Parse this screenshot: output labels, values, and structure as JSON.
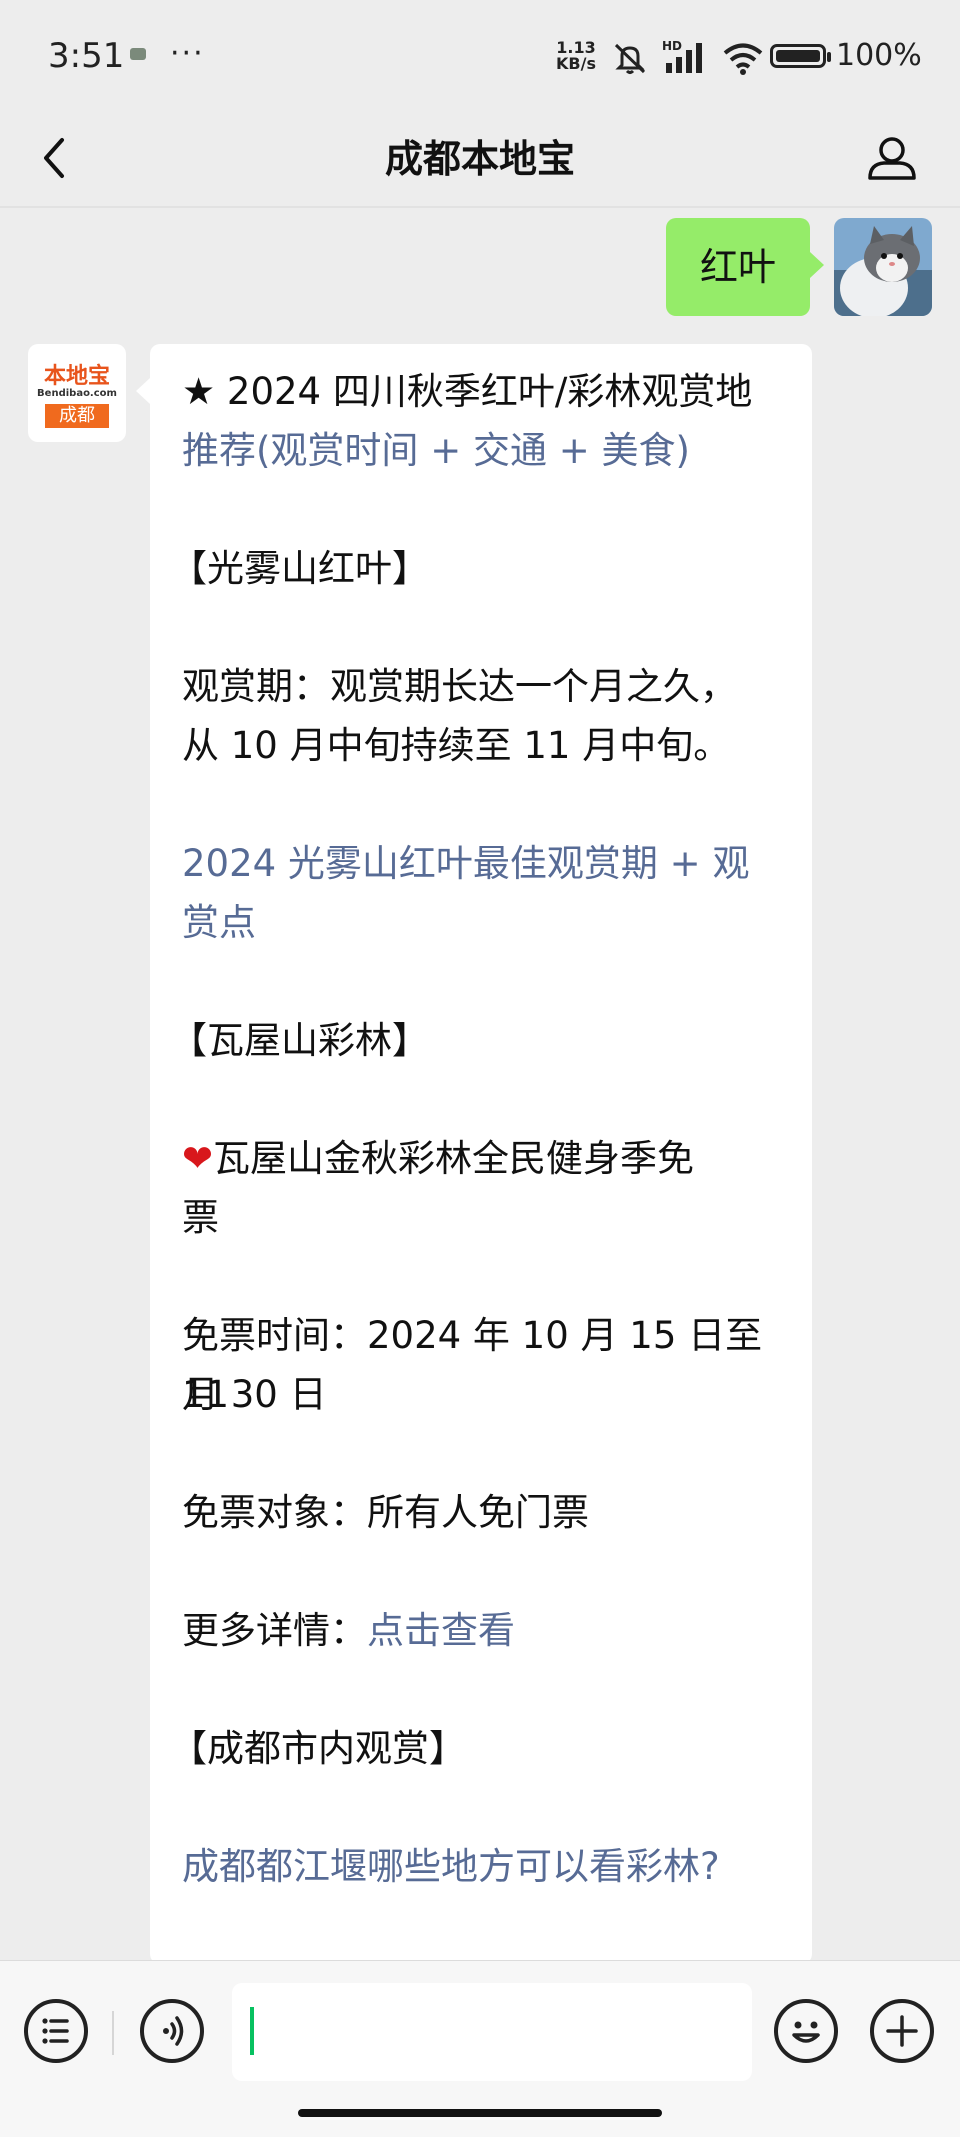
{
  "status_bar": {
    "time": "3:51",
    "dots": "···",
    "net_speed_value": "1.13",
    "net_speed_unit": "KB/s",
    "network_label": "HD",
    "battery_percent": "100%"
  },
  "header": {
    "title": "成都本地宝"
  },
  "messages": {
    "user_message": "红叶",
    "official_avatar": {
      "top": "本地宝",
      "mid": "Bendibao.com",
      "bottom": "成都"
    },
    "reply": {
      "link_title_1": "★ 2024 四川秋季红叶/彩林观赏地",
      "link_title_2": "推荐(观赏时间 + 交通 + 美食)",
      "section1": "【光雾山红叶】",
      "period_1": "观赏期：观赏期长达一个月之久，",
      "period_2": "从 10 月中旬持续至 11 月中旬。",
      "link_best_1": "2024 光雾山红叶最佳观赏期 + 观",
      "link_best_2": "赏点",
      "section2": "【瓦屋山彩林】",
      "heart": "❤",
      "event_1": "瓦屋山金秋彩林全民健身季免",
      "event_2": "票",
      "free_time_1": "免票时间：2024 年 10 月 15 日至 11",
      "free_time_2": "月 30 日",
      "free_target": "免票对象：所有人免门票",
      "more_label": "更多详情：",
      "more_link": "点击查看",
      "section3": "【成都市内观赏】",
      "link_cd": "成都都江堰哪些地方可以看彩林?"
    }
  },
  "colors": {
    "link": "#576b95",
    "self_bubble": "#95ec69",
    "cursor": "#07c160"
  },
  "icons": [
    "back-icon",
    "profile-icon",
    "list-menu-icon",
    "voice-icon",
    "emoji-icon",
    "plus-icon"
  ]
}
